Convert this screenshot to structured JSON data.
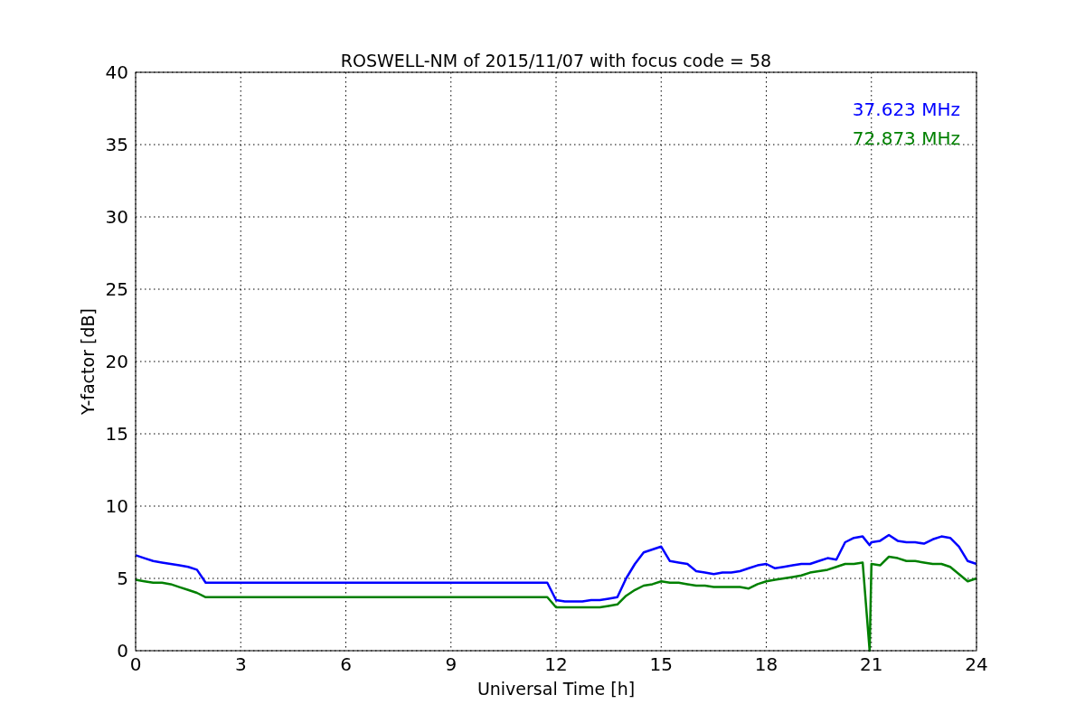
{
  "figure": {
    "chart_data": {
      "type": "line",
      "title": "ROSWELL-NM of 2015/11/07 with focus code = 58",
      "xlabel": "Universal Time [h]",
      "ylabel": "Y-factor [dB]",
      "x": [
        0,
        0.25,
        0.5,
        0.75,
        1,
        1.25,
        1.5,
        1.75,
        2,
        2.25,
        2.5,
        2.75,
        3,
        3.25,
        3.5,
        3.75,
        4,
        4.25,
        4.5,
        4.75,
        5,
        5.25,
        5.5,
        5.75,
        6,
        6.25,
        6.5,
        6.75,
        7,
        7.25,
        7.5,
        7.75,
        8,
        8.25,
        8.5,
        8.75,
        9,
        9.25,
        9.5,
        9.75,
        10,
        10.25,
        10.5,
        10.75,
        11,
        11.25,
        11.5,
        11.75,
        12,
        12.25,
        12.5,
        12.75,
        13,
        13.25,
        13.5,
        13.75,
        14,
        14.25,
        14.5,
        14.75,
        15,
        15.25,
        15.5,
        15.75,
        16,
        16.25,
        16.5,
        16.75,
        17,
        17.25,
        17.5,
        17.75,
        18,
        18.25,
        18.5,
        18.75,
        19,
        19.25,
        19.5,
        19.75,
        20,
        20.25,
        20.5,
        20.75,
        20.95,
        21,
        21.25,
        21.5,
        21.75,
        22,
        22.25,
        22.5,
        22.75,
        23,
        23.25,
        23.5,
        23.75,
        24
      ],
      "series": [
        {
          "name": "37.623 MHz",
          "color": "#0000ff",
          "values": [
            6.6,
            6.4,
            6.2,
            6.1,
            6.0,
            5.9,
            5.8,
            5.6,
            4.7,
            4.7,
            4.7,
            4.7,
            4.7,
            4.7,
            4.7,
            4.7,
            4.7,
            4.7,
            4.7,
            4.7,
            4.7,
            4.7,
            4.7,
            4.7,
            4.7,
            4.7,
            4.7,
            4.7,
            4.7,
            4.7,
            4.7,
            4.7,
            4.7,
            4.7,
            4.7,
            4.7,
            4.7,
            4.7,
            4.7,
            4.7,
            4.7,
            4.7,
            4.7,
            4.7,
            4.7,
            4.7,
            4.7,
            4.7,
            3.5,
            3.4,
            3.4,
            3.4,
            3.5,
            3.5,
            3.6,
            3.7,
            5.0,
            6.0,
            6.8,
            7.0,
            7.2,
            6.2,
            6.1,
            6.0,
            5.5,
            5.4,
            5.3,
            5.4,
            5.4,
            5.5,
            5.7,
            5.9,
            6.0,
            5.7,
            5.8,
            5.9,
            6.0,
            6.0,
            6.2,
            6.4,
            6.3,
            7.5,
            7.8,
            7.9,
            7.3,
            7.5,
            7.6,
            8.0,
            7.6,
            7.5,
            7.5,
            7.4,
            7.7,
            7.9,
            7.8,
            7.2,
            6.2,
            6.0
          ]
        },
        {
          "name": "72.873 MHz",
          "color": "#008000",
          "values": [
            4.9,
            4.8,
            4.7,
            4.7,
            4.6,
            4.4,
            4.2,
            4.0,
            3.7,
            3.7,
            3.7,
            3.7,
            3.7,
            3.7,
            3.7,
            3.7,
            3.7,
            3.7,
            3.7,
            3.7,
            3.7,
            3.7,
            3.7,
            3.7,
            3.7,
            3.7,
            3.7,
            3.7,
            3.7,
            3.7,
            3.7,
            3.7,
            3.7,
            3.7,
            3.7,
            3.7,
            3.7,
            3.7,
            3.7,
            3.7,
            3.7,
            3.7,
            3.7,
            3.7,
            3.7,
            3.7,
            3.7,
            3.7,
            3.0,
            3.0,
            3.0,
            3.0,
            3.0,
            3.0,
            3.1,
            3.2,
            3.8,
            4.2,
            4.5,
            4.6,
            4.8,
            4.7,
            4.7,
            4.6,
            4.5,
            4.5,
            4.4,
            4.4,
            4.4,
            4.4,
            4.3,
            4.6,
            4.8,
            4.9,
            5.0,
            5.1,
            5.2,
            5.4,
            5.5,
            5.6,
            5.8,
            6.0,
            6.0,
            6.1,
            0,
            6.0,
            5.9,
            6.5,
            6.4,
            6.2,
            6.2,
            6.1,
            6.0,
            6.0,
            5.8,
            5.3,
            4.8,
            5.0
          ]
        }
      ],
      "xlim": [
        0,
        24
      ],
      "ylim": [
        0,
        40
      ],
      "xticks": [
        0,
        3,
        6,
        9,
        12,
        15,
        18,
        21,
        24
      ],
      "yticks": [
        0,
        5,
        10,
        15,
        20,
        25,
        30,
        35,
        40
      ],
      "grid": true
    }
  }
}
